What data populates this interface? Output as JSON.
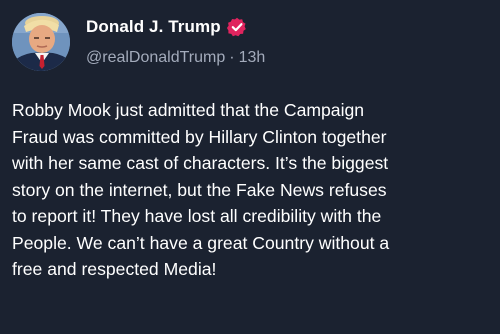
{
  "post": {
    "author": {
      "display_name": "Donald J. Trump",
      "handle": "@realDonaldTrump",
      "verified_icon": "verified-badge-icon",
      "avatar": "profile-photo"
    },
    "timestamp": "13h",
    "separator": "·",
    "text": "Robby Mook just admitted that the Campaign\nFraud was committed by Hillary Clinton together\nwith her same cast of characters. It’s the biggest\nstory on the internet, but the Fake News refuses\nto report it! They have lost all credibility with the\nPeople. We can’t have a great Country without a\nfree and respected Media!"
  },
  "colors": {
    "background": "#1b2230",
    "text": "#ffffff",
    "muted": "#a3abbb",
    "verified": "#e0245e"
  }
}
